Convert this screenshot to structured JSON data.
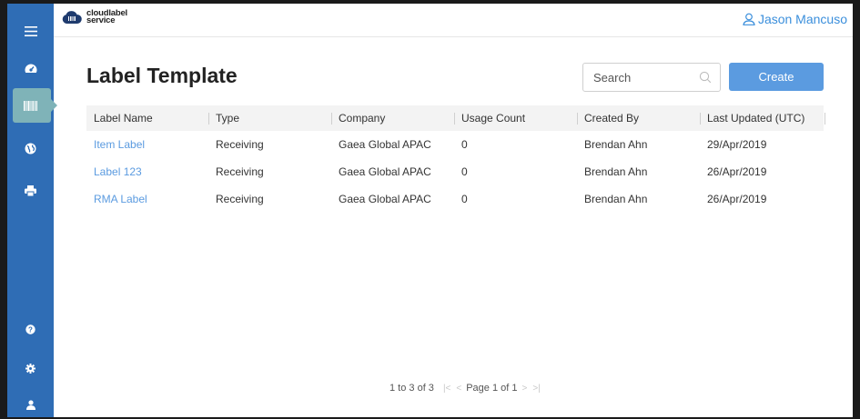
{
  "app": {
    "logo_line1": "cloudlabel",
    "logo_line2": "service"
  },
  "user": {
    "name": "Jason Mancuso"
  },
  "page": {
    "title": "Label Template"
  },
  "search": {
    "placeholder": "Search",
    "value": ""
  },
  "toolbar": {
    "create_label": "Create"
  },
  "sidebar": {
    "items": [
      {
        "name": "menu",
        "icon": "hamburger-icon"
      },
      {
        "name": "dashboard",
        "icon": "dashboard-gauge-icon"
      },
      {
        "name": "label-templates",
        "icon": "barcode-icon",
        "active": true
      },
      {
        "name": "globe",
        "icon": "globe-icon"
      },
      {
        "name": "printers",
        "icon": "printer-icon"
      },
      {
        "name": "help",
        "icon": "question-icon"
      },
      {
        "name": "settings",
        "icon": "gear-icon"
      },
      {
        "name": "account",
        "icon": "user-icon"
      }
    ]
  },
  "table": {
    "columns": [
      "Label Name",
      "Type",
      "Company",
      "Usage Count",
      "Created By",
      "Last Updated (UTC)"
    ],
    "rows": [
      [
        "Item Label",
        "Receiving",
        "Gaea Global APAC",
        "0",
        "Brendan Ahn",
        "29/Apr/2019"
      ],
      [
        "Label 123",
        "Receiving",
        "Gaea Global APAC",
        "0",
        "Brendan Ahn",
        "26/Apr/2019"
      ],
      [
        "RMA Label",
        "Receiving",
        "Gaea Global APAC",
        "0",
        "Brendan Ahn",
        "26/Apr/2019"
      ]
    ]
  },
  "pagination": {
    "range_text": "1 to 3 of 3",
    "page_text": "Page 1 of 1",
    "first": "|<",
    "prev": "<",
    "next": ">",
    "last": ">|"
  },
  "colors": {
    "sidebar": "#2f6db5",
    "sidebar_active": "#7fb3b8",
    "accent": "#5b9be0",
    "link": "#5b9be0"
  }
}
